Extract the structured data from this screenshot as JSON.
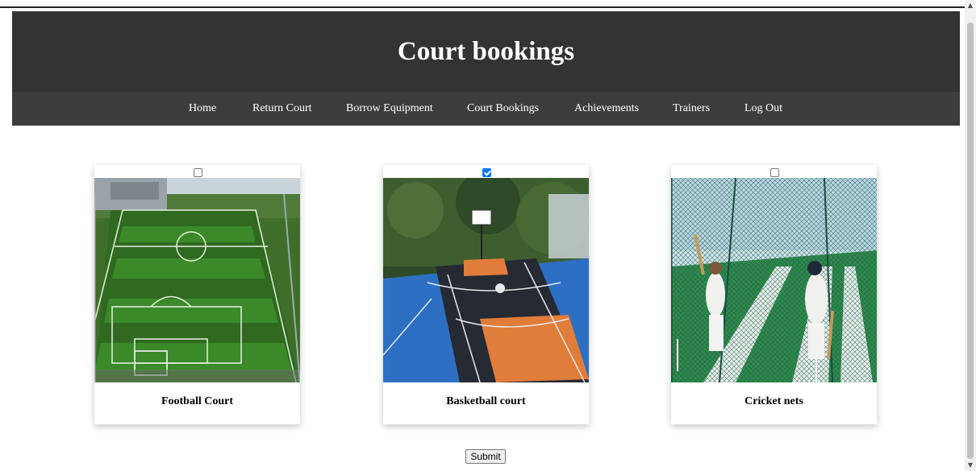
{
  "header": {
    "title": "Court bookings"
  },
  "nav": {
    "items": [
      {
        "label": "Home"
      },
      {
        "label": "Return Court"
      },
      {
        "label": "Borrow Equipment"
      },
      {
        "label": "Court Bookings"
      },
      {
        "label": "Achievements"
      },
      {
        "label": "Trainers"
      },
      {
        "label": "Log Out"
      }
    ]
  },
  "courts": [
    {
      "name": "Football Court",
      "selected": false
    },
    {
      "name": "Basketball court",
      "selected": true
    },
    {
      "name": "Cricket nets",
      "selected": false
    }
  ],
  "form": {
    "submit_label": "Submit"
  },
  "colors": {
    "header_bg": "#333333",
    "nav_bg": "#3d3d3d",
    "checkbox_checked": "#0075ff"
  }
}
